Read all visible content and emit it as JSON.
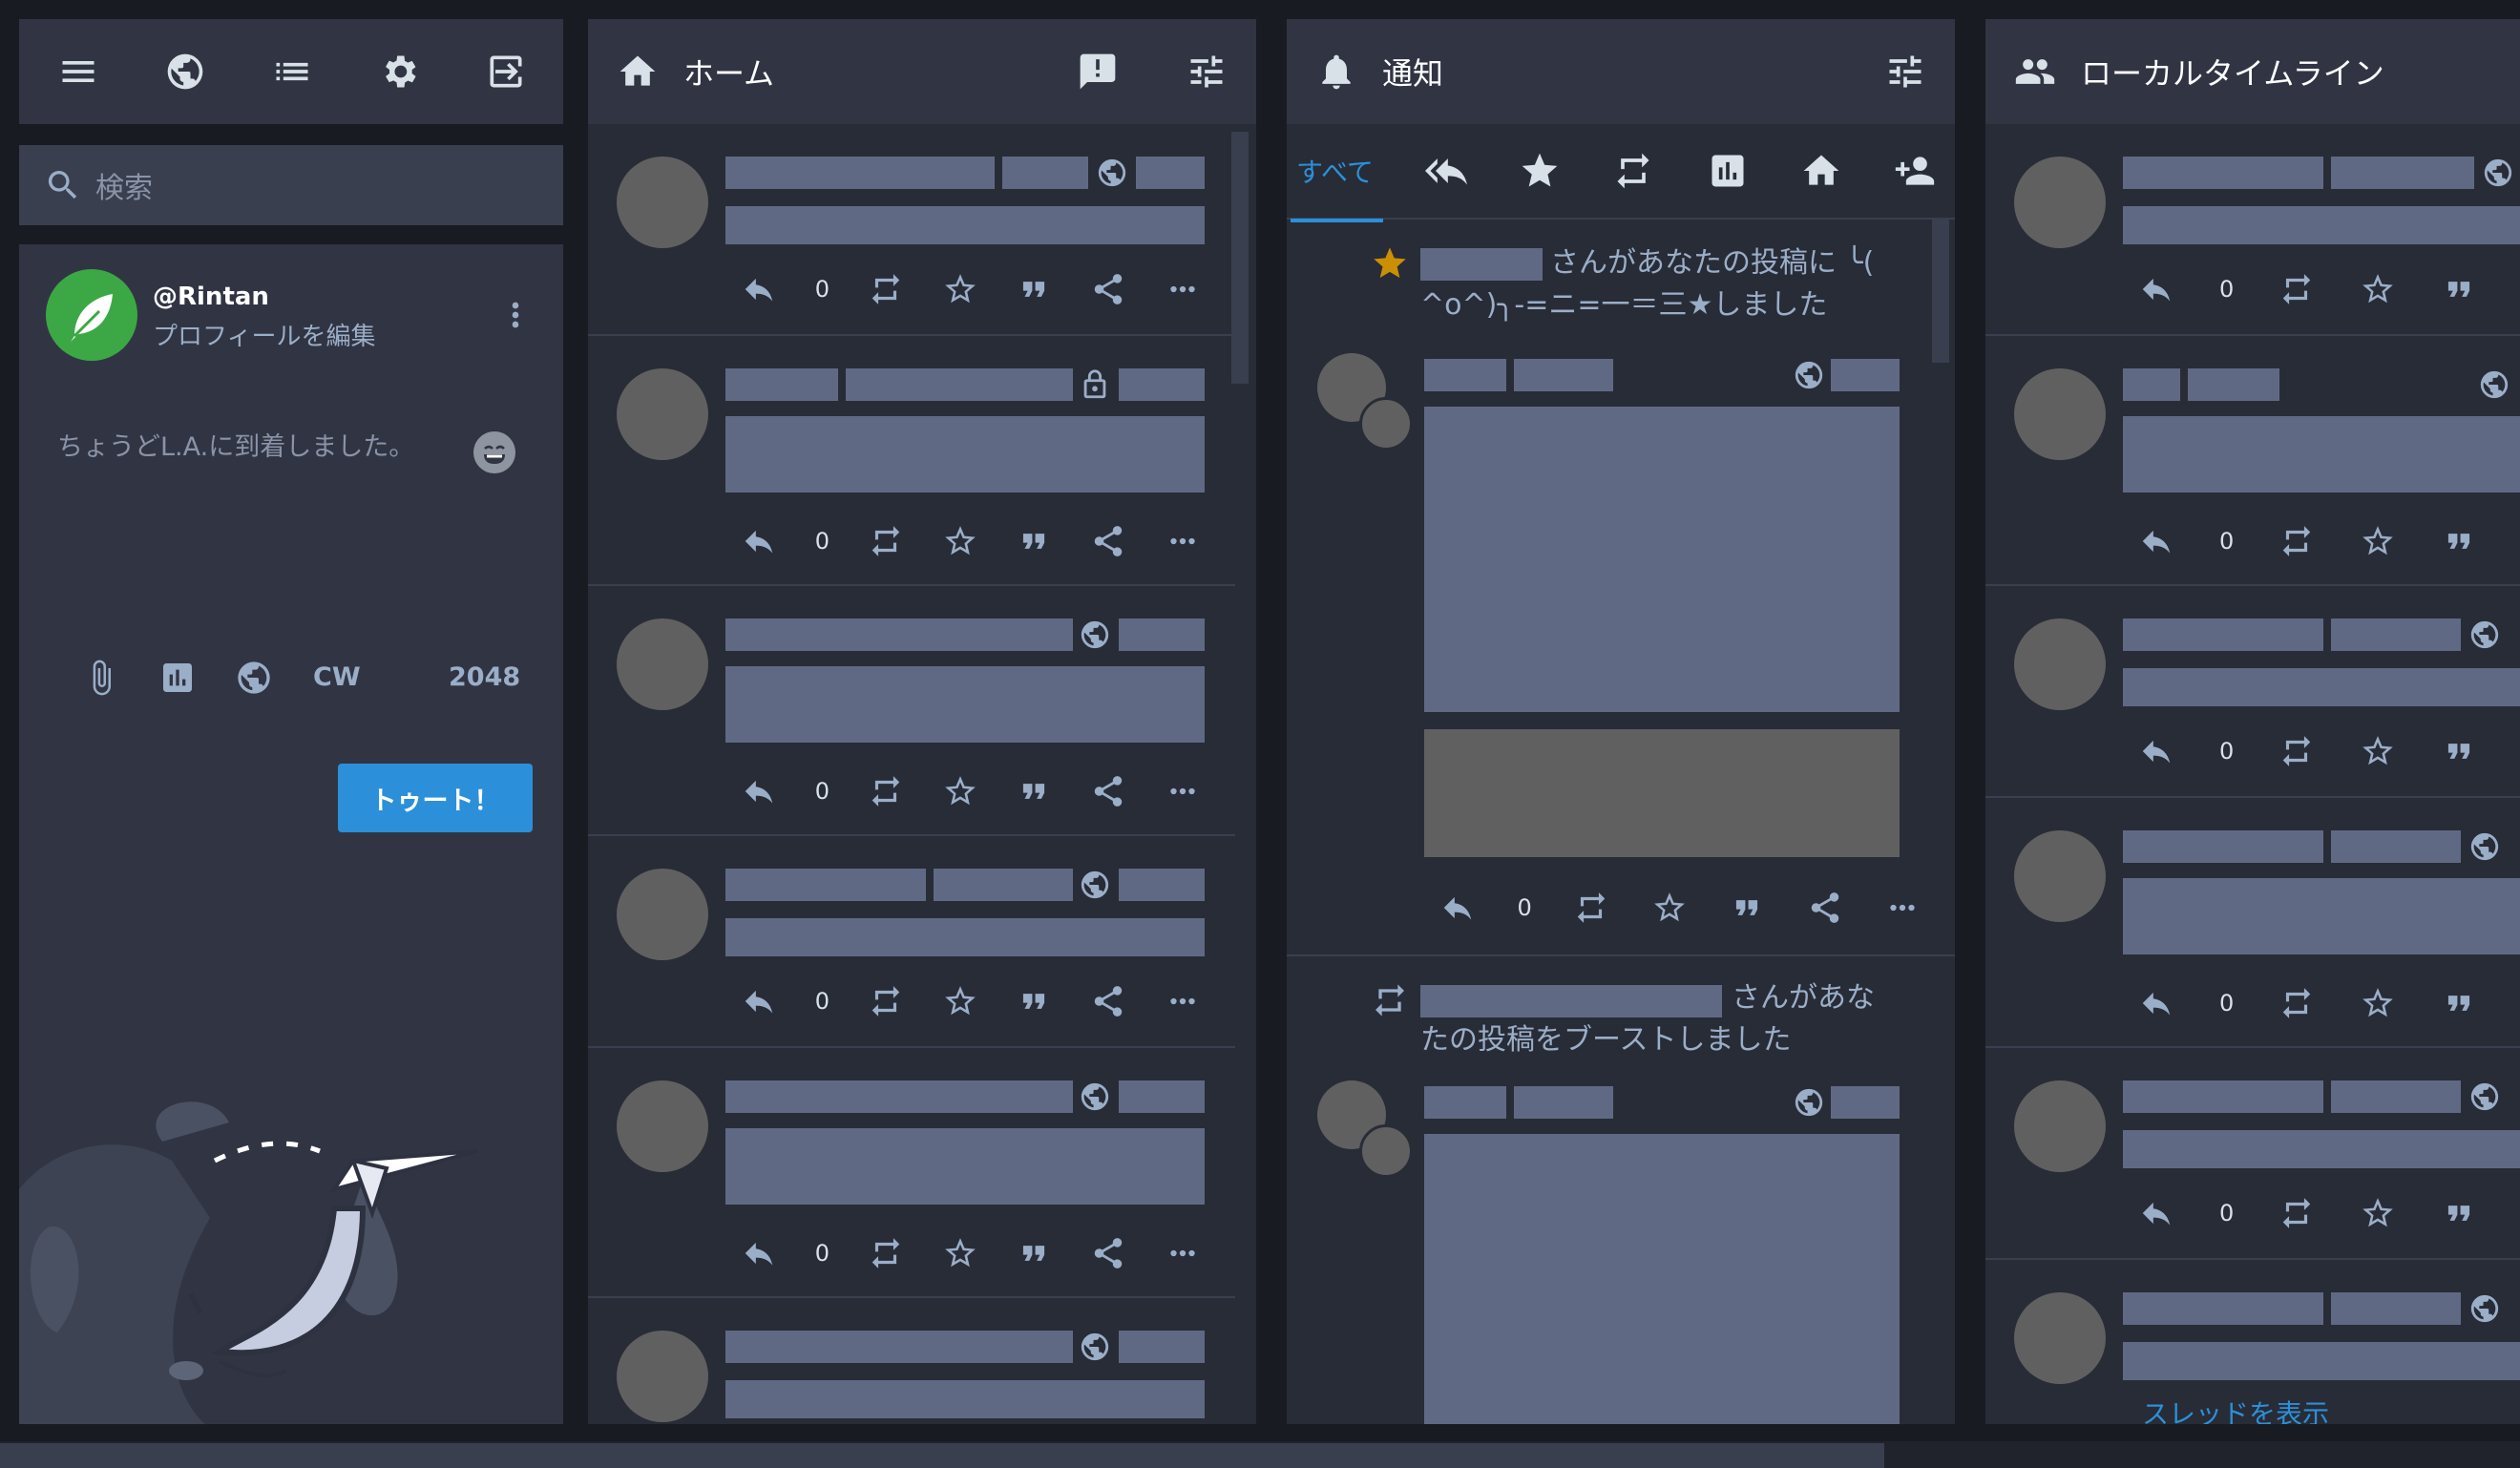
{
  "nav": {
    "icons": [
      "menu-icon",
      "globe-icon",
      "list-icon",
      "gear-icon",
      "logout-icon"
    ]
  },
  "search": {
    "placeholder": "検索"
  },
  "profile": {
    "handle": "@Rintan",
    "edit_label": "プロフィールを編集"
  },
  "compose": {
    "text": "ちょうどL.A.に到着しました。",
    "cw_label": "CW",
    "char_count": "2048",
    "toot_button": "トゥート！"
  },
  "home": {
    "title": "ホーム",
    "count": "0"
  },
  "notifications": {
    "title": "通知",
    "tab_all": "すべて",
    "fav_text": "さんがあなたの投稿に ╰( ^o^)╮-=ニ=一＝三★しました",
    "boost_text": "さんがあなたの投稿をブーストしました",
    "count": "0"
  },
  "local": {
    "title": "ローカルタイムライン",
    "count": "0",
    "thread_link": "スレッドを表示"
  },
  "colors": {
    "accent": "#2b90d9",
    "brand_green": "#3ca845",
    "panel": "#313543",
    "column": "#282c37",
    "placeholder": "#606984"
  }
}
